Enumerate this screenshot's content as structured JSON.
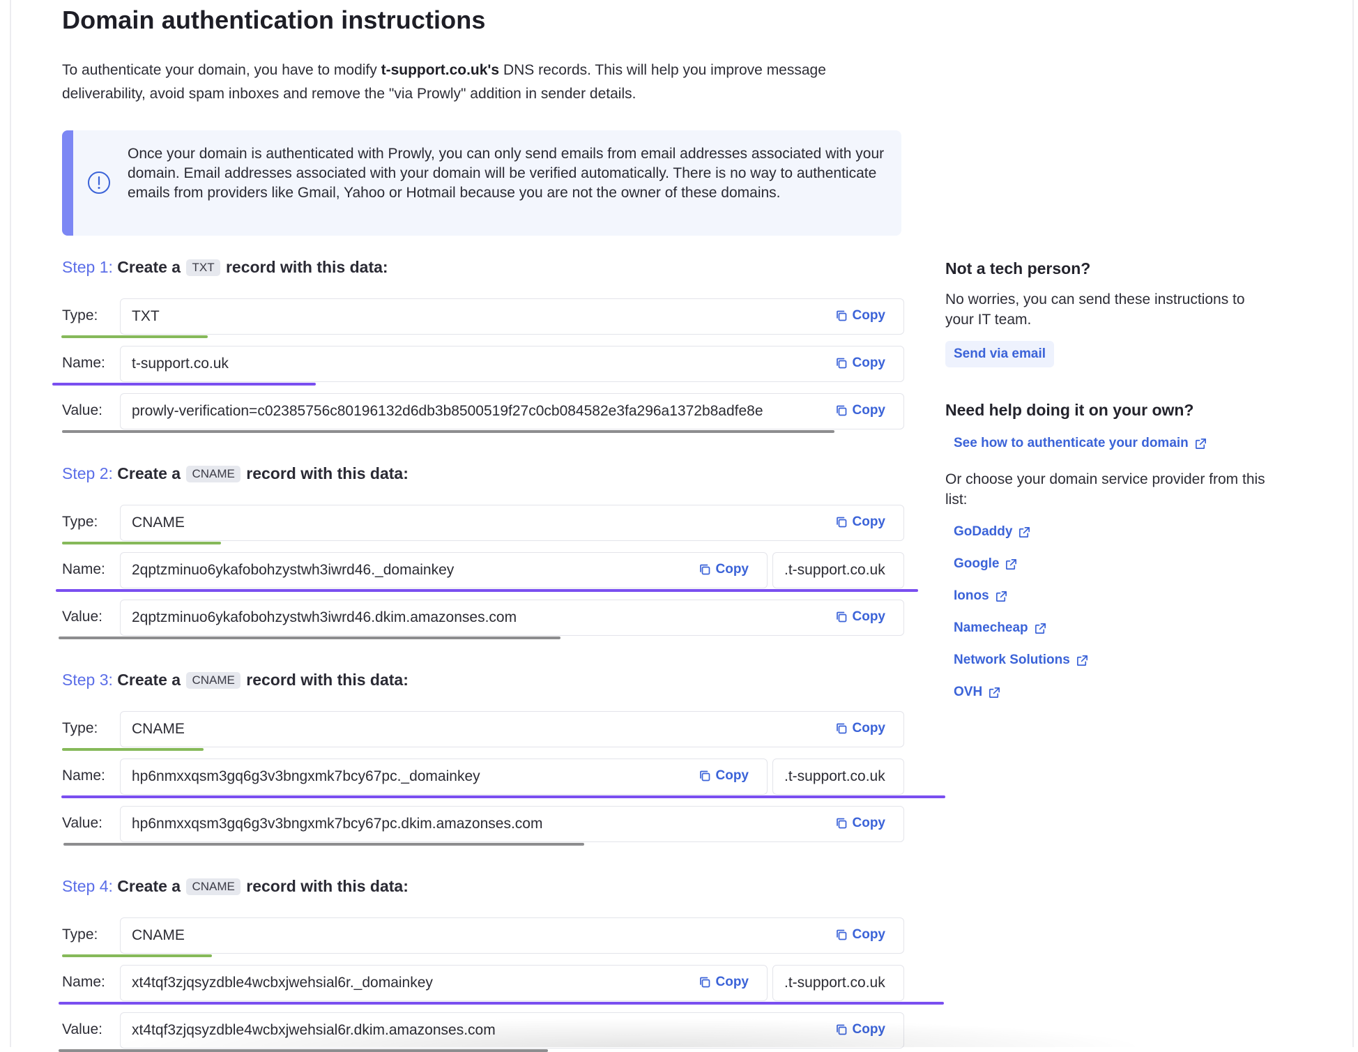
{
  "title": "Domain authentication instructions",
  "intro": {
    "before": "To authenticate your domain, you have to modify ",
    "domain": "t-support.co.uk's",
    "after": " DNS records. This will help you improve message deliverability, avoid spam inboxes and remove the \"via Prowly\" addition in sender details."
  },
  "info_box": {
    "icon": "info-circle-icon",
    "text": "Once your domain is authenticated with Prowly, you can only send emails from email addresses associated with your domain. Email addresses associated with your domain will be verified automatically. There is no way to authenticate emails from providers like Gmail, Yahoo or Hotmail because you are not the owner of these domains."
  },
  "labels": {
    "type": "Type:",
    "name": "Name:",
    "value": "Value:",
    "copy": "Copy"
  },
  "steps": [
    {
      "label": "Step",
      "num": "1:",
      "pre": "Create a",
      "tag": "TXT",
      "post": "record with this data:",
      "type": "TXT",
      "name": "t-support.co.uk",
      "name_suffix": "",
      "value": "prowly-verification=c02385756c80196132d6db3b8500519f27c0cb084582e3fa296a1372b8adfe8e"
    },
    {
      "label": "Step",
      "num": "2:",
      "pre": "Create a",
      "tag": "CNAME",
      "post": "record with this data:",
      "type": "CNAME",
      "name": "2qptzminuo6ykafobohzystwh3iwrd46._domainkey",
      "name_suffix": ".t-support.co.uk",
      "value": "2qptzminuo6ykafobohzystwh3iwrd46.dkim.amazonses.com"
    },
    {
      "label": "Step",
      "num": "3:",
      "pre": "Create a",
      "tag": "CNAME",
      "post": "record with this data:",
      "type": "CNAME",
      "name": "hp6nmxxqsm3gq6g3v3bngxmk7bcy67pc._domainkey",
      "name_suffix": ".t-support.co.uk",
      "value": "hp6nmxxqsm3gq6g3v3bngxmk7bcy67pc.dkim.amazonses.com"
    },
    {
      "label": "Step",
      "num": "4:",
      "pre": "Create a",
      "tag": "CNAME",
      "post": "record with this data:",
      "type": "CNAME",
      "name": "xt4tqf3zjqsyzdble4wcbxjwehsial6r._domainkey",
      "name_suffix": ".t-support.co.uk",
      "value": "xt4tqf3zjqsyzdble4wcbxjwehsial6r.dkim.amazonses.com"
    }
  ],
  "sidebar": {
    "tech_title": "Not a tech person?",
    "tech_text": "No worries, you can send these instructions to your IT team.",
    "send_button": "Send via email",
    "help_title": "Need help doing it on your own?",
    "help_link": "See how to authenticate your domain",
    "choose_text": "Or choose your domain service provider from this list:",
    "providers": [
      "GoDaddy",
      "Google",
      "Ionos",
      "Namecheap",
      "Network Solutions",
      "OVH"
    ]
  },
  "colors": {
    "accent": "#3b63d8",
    "step": "#5b6ee8",
    "info_bar": "#7c87f4",
    "green_line": "#86b95a",
    "purple_line": "#7a4ff0",
    "gray_line": "#8d8d8f"
  }
}
